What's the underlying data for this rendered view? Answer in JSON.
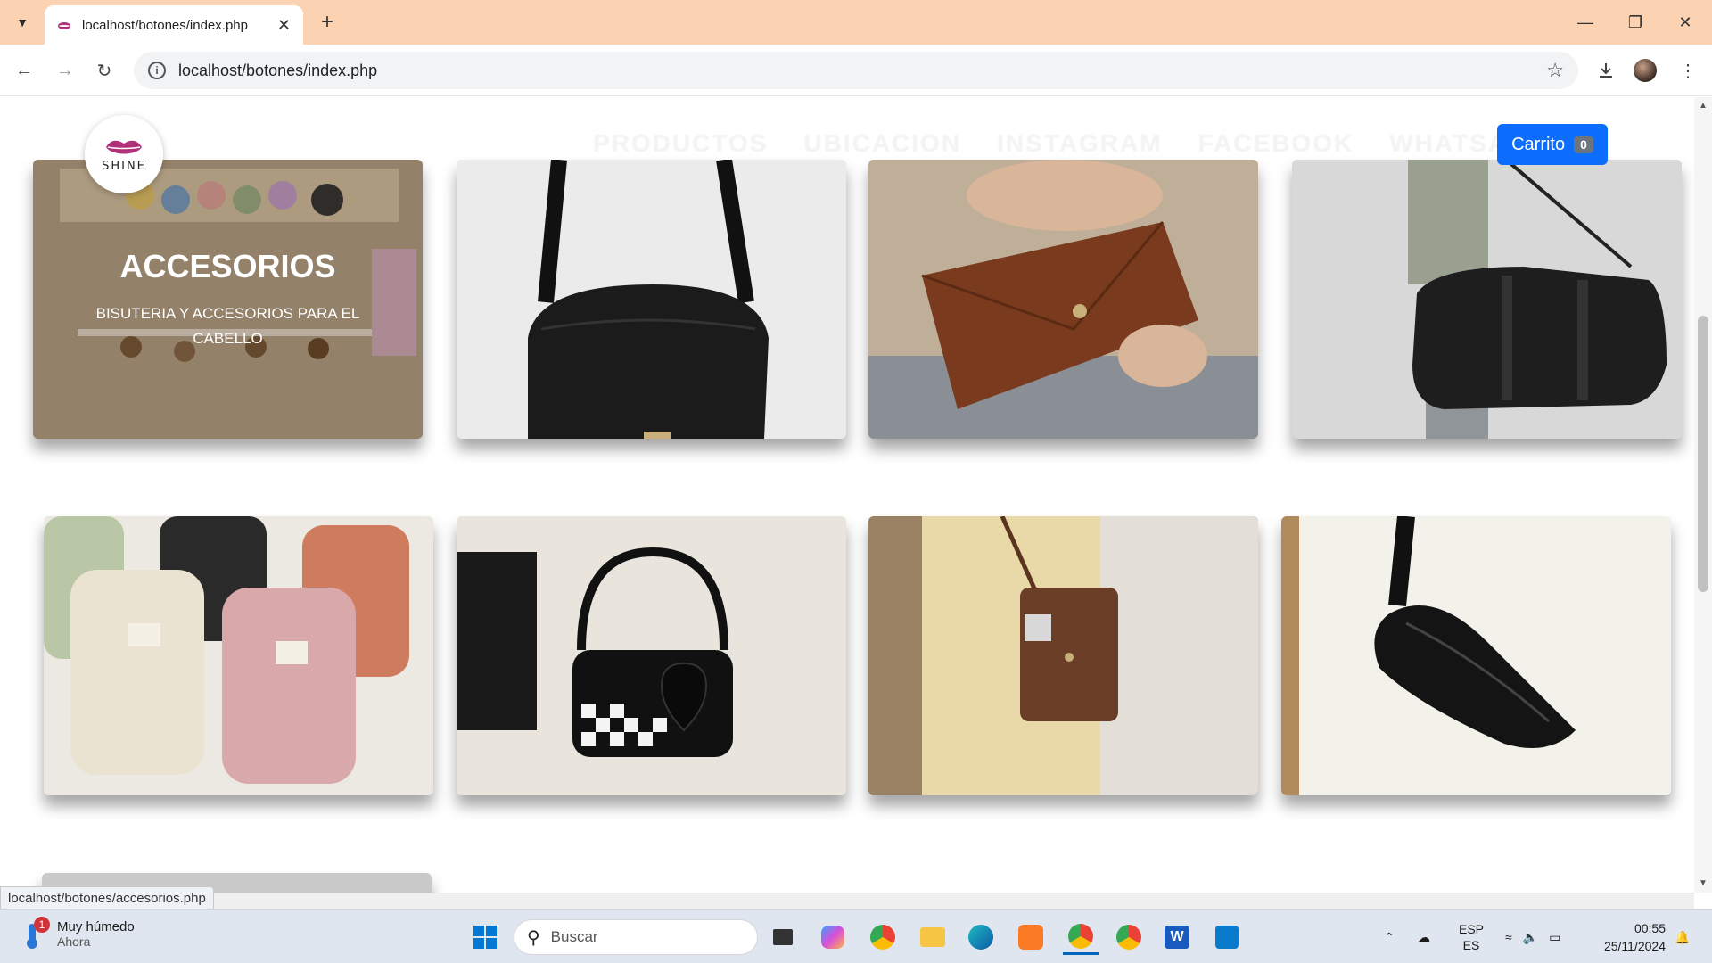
{
  "browser": {
    "tab_title": "localhost/botones/index.php",
    "url": "localhost/botones/index.php",
    "status_url": "localhost/botones/accesorios.php"
  },
  "site": {
    "brand": "SHINE",
    "nav": [
      "PRODUCTOS",
      "UBICACION",
      "INSTAGRAM",
      "FACEBOOK",
      "WHATSAPP"
    ],
    "cart_label": "Carrito",
    "cart_count": "0"
  },
  "cards": [
    {
      "heading": "ACCESORIOS",
      "subtitle": "BISUTERIA Y ACCESORIOS PARA EL CABELLO",
      "image": "hair-accessories"
    },
    {
      "image": "black-crossbody-bag"
    },
    {
      "image": "brown-leather-wallet"
    },
    {
      "image": "black-duffel-bag"
    },
    {
      "image": "pastel-backpacks"
    },
    {
      "image": "checkered-heart-handbag"
    },
    {
      "image": "brown-phone-pouch"
    },
    {
      "image": "black-fanny-pack"
    }
  ],
  "taskbar": {
    "weather_title": "Muy húmedo",
    "weather_sub": "Ahora",
    "weather_badge": "1",
    "search_placeholder": "Buscar",
    "lang_top": "ESP",
    "lang_bottom": "ES",
    "time": "00:55",
    "date": "25/11/2024"
  }
}
